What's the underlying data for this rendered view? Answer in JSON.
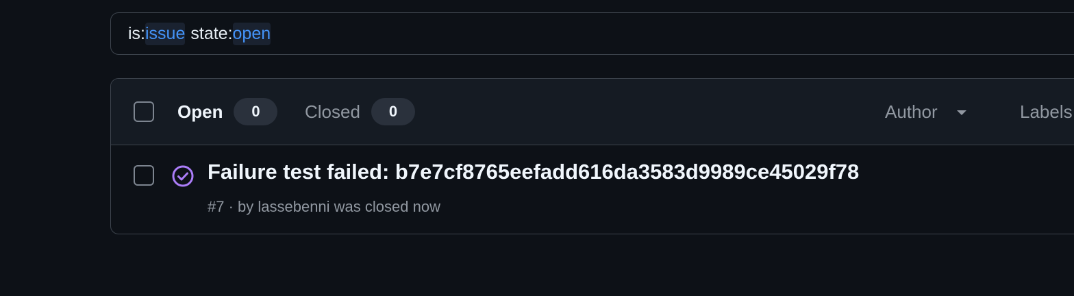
{
  "search": {
    "tokens": [
      {
        "key": "is:",
        "value": "issue"
      },
      {
        "key": "state:",
        "value": "open"
      }
    ]
  },
  "tabs": {
    "open": {
      "label": "Open",
      "count": "0"
    },
    "closed": {
      "label": "Closed",
      "count": "0"
    }
  },
  "filters": {
    "author": "Author",
    "labels": "Labels"
  },
  "issues": [
    {
      "title": "Failure test failed: b7e7cf8765eefadd616da3583d9989ce45029f78",
      "meta": "#7 · by lassebenni was closed now",
      "status": "closed-completed",
      "status_icon": "issue-closed-icon",
      "status_color": "#ab7df8"
    }
  ],
  "colors": {
    "background": "#0d1117",
    "header_bg": "#151b23",
    "border": "#3d444d",
    "accent_blue": "#4493f8",
    "closed_purple": "#ab7df8"
  }
}
